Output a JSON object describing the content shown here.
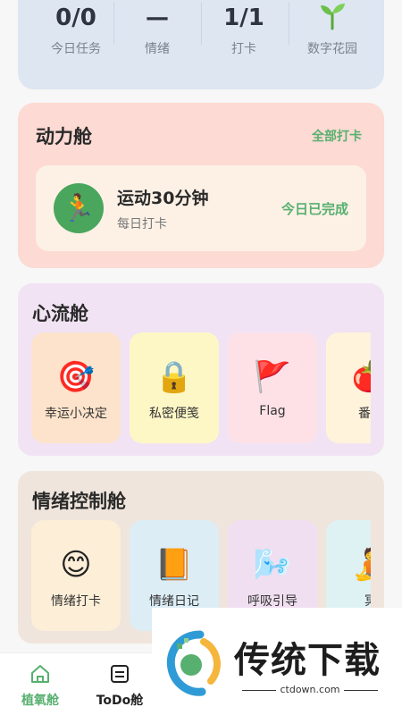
{
  "stats": [
    {
      "value": "0/0",
      "label": "今日任务"
    },
    {
      "value": "—",
      "label": "情绪"
    },
    {
      "value": "1/1",
      "label": "打卡"
    },
    {
      "value": "",
      "icon": "sprout-icon",
      "label": "数字花园"
    }
  ],
  "power": {
    "title": "动力舱",
    "all_link": "全部打卡",
    "item": {
      "icon": "runner-icon",
      "name": "运动30分钟",
      "sub": "每日打卡",
      "status": "今日已完成"
    }
  },
  "flow": {
    "title": "心流舱",
    "tiles": [
      {
        "icon": "target-icon",
        "glyph": "🎯",
        "label": "幸运小决定",
        "color": "#fde3cb"
      },
      {
        "icon": "lock-icon",
        "glyph": "🔒",
        "label": "私密便笺",
        "color": "#fdf7c6"
      },
      {
        "icon": "flag-icon",
        "glyph": "🚩",
        "label": "Flag",
        "color": "#fde1e7"
      },
      {
        "icon": "tomato-icon",
        "glyph": "🍅",
        "label": "番茄",
        "color": "#fff3dc"
      }
    ]
  },
  "emotion": {
    "title": "情绪控制舱",
    "tiles": [
      {
        "icon": "smile-icon",
        "glyph": "😊",
        "label": "情绪打卡",
        "color": "#fdeed7"
      },
      {
        "icon": "book-icon",
        "glyph": "📙",
        "label": "情绪日记",
        "color": "#dcedf6"
      },
      {
        "icon": "wind-icon",
        "glyph": "🌬️",
        "label": "呼吸引导",
        "color": "#f0dff0"
      },
      {
        "icon": "meditation-icon",
        "glyph": "🧘",
        "label": "冥",
        "color": "#def1f3"
      }
    ]
  },
  "nav": {
    "tabs": [
      {
        "label": "植氧舱",
        "icon": "home-icon",
        "active": true
      },
      {
        "label": "ToDo舱",
        "icon": "todo-icon",
        "active": false
      }
    ]
  },
  "watermark": {
    "title": "传统下载",
    "url": "ctdown.com"
  },
  "colors": {
    "accent_green": "#57b06f",
    "stats_bg": "#dde6f1",
    "power_bg": "#fddad3",
    "flow_bg": "#f1e3f4",
    "emotion_bg": "#f0e5dc"
  }
}
